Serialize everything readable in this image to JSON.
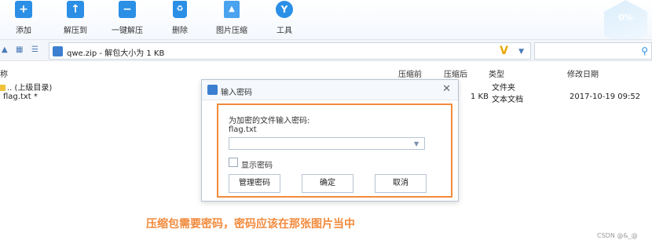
{
  "toolbar": {
    "items": [
      {
        "label": "添加",
        "icon": "add-icon"
      },
      {
        "label": "解压到",
        "icon": "extract-to-icon"
      },
      {
        "label": "一键解压",
        "icon": "one-click-extract-icon"
      },
      {
        "label": "删除",
        "icon": "trash-icon"
      },
      {
        "label": "图片压缩",
        "icon": "image-compress-icon"
      },
      {
        "label": "工具",
        "icon": "tools-icon"
      }
    ],
    "deco": "0%"
  },
  "address": {
    "path": "qwe.zip - 解包大小为 1 KB",
    "search_placeholder": ""
  },
  "columns": {
    "name": "称",
    "compressed_before": "压缩前",
    "compressed_after": "压缩后",
    "type": "类型",
    "modified": "修改日期"
  },
  "files": [
    {
      "name": ".. (上级目录)",
      "size": "",
      "type": "文件夹",
      "date": ""
    },
    {
      "name": "flag.txt *",
      "size": "1 KB",
      "type": "文本文档",
      "date": "2017-10-19 09:52"
    }
  ],
  "dialog": {
    "title": "输入密码",
    "prompt": "为加密的文件输入密码:",
    "filename": "flag.txt",
    "password_value": "",
    "show_password": "显示密码",
    "btn_manage": "管理密码",
    "btn_ok": "确定",
    "btn_cancel": "取消"
  },
  "annotation": "压缩包需要密码，密码应该在那张图片当中",
  "watermark": "CSDN @&_@",
  "colors": {
    "accent": "#2b8fe6",
    "highlight": "#f28a3c"
  }
}
